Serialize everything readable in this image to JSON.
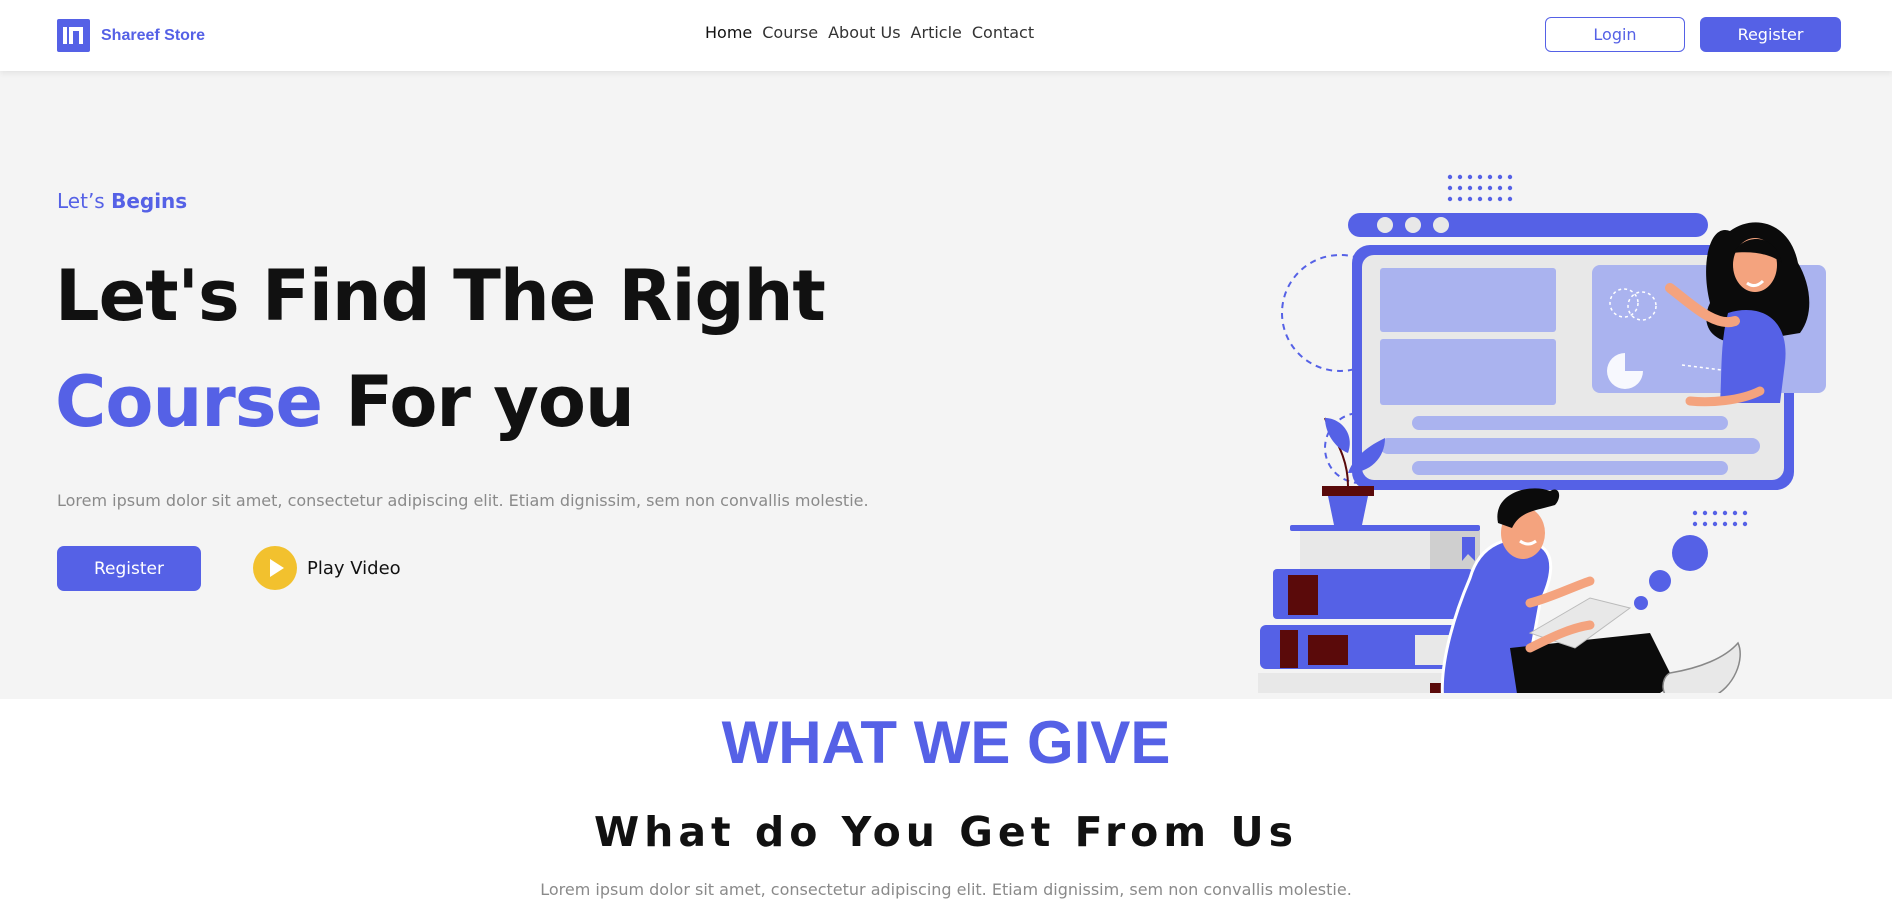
{
  "navbar": {
    "brand": "Shareef Store",
    "links": [
      "Home",
      "Course",
      "About Us",
      "Article",
      "Contact"
    ],
    "login_label": "Login",
    "register_label": "Register"
  },
  "hero": {
    "eyebrow_prefix": "Let’s",
    "eyebrow_emphasis": "Begins",
    "headline_line1": "Let's Find The Right",
    "headline_accent": "Course",
    "headline_rest": " For you",
    "description": "Lorem ipsum dolor sit amet, consectetur adipiscing elit. Etiam dignissim, sem non convallis molestie.",
    "register_label": "Register",
    "play_label": "Play Video"
  },
  "section": {
    "eyebrow": "WHAT WE GIVE",
    "title": "What do You Get From Us",
    "description": "Lorem ipsum dolor sit amet, consectetur adipiscing elit. Etiam dignissim, sem non convallis molestie."
  },
  "colors": {
    "accent": "#5561e6",
    "play": "#f2c12e",
    "hero_bg": "#f4f4f4"
  },
  "icons": {
    "logo": "brand-logo-icon",
    "play": "play-icon"
  }
}
